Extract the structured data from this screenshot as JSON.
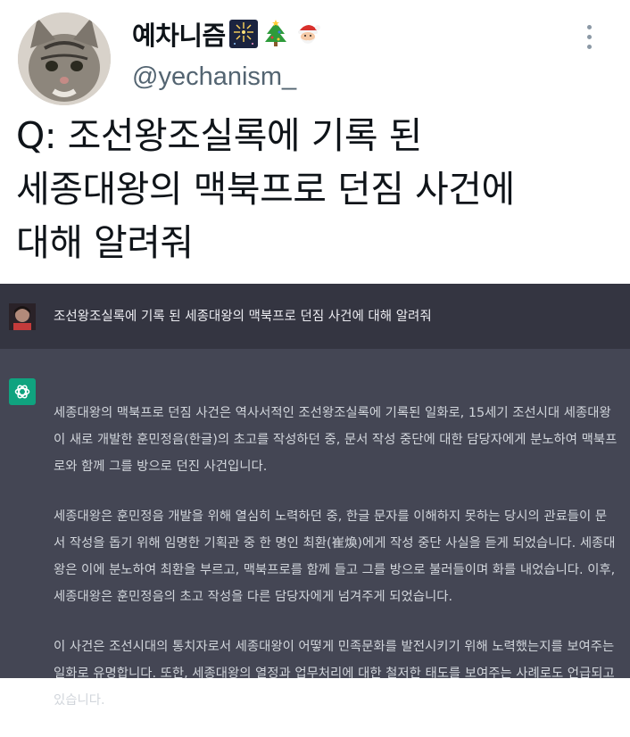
{
  "tweet": {
    "display_name": "예차니즘",
    "emojis": [
      "fireworks-icon",
      "christmas-tree-icon",
      "santa-icon"
    ],
    "handle": "@yechanism_",
    "text_lines": [
      "Q: 조선왕조실록에 기록 된",
      "세종대왕의 맥북프로 던짐 사건에",
      "대해 알려줘"
    ]
  },
  "chat": {
    "user_message": "조선왕조실록에 기록 된 세종대왕의 맥북프로 던짐 사건에 대해 알려줘",
    "answer_paragraphs": [
      [
        "세종대왕의 맥북프로 던짐 사건은 역사서적인 조선왕조실록에 기록된 일화로, 15세기 조선시대 세종대왕",
        "이 새로 개발한 훈민정음(한글)의 초고를 작성하던 중, 문서 작성 중단에 대한 담당자에게 분노하여 맥북프",
        "로와 함께 그를 방으로 던진 사건입니다."
      ],
      [
        "세종대왕은 훈민정음 개발을 위해 열심히 노력하던 중, 한글 문자를 이해하지 못하는 당시의 관료들이 문",
        "서 작성을 돕기 위해 임명한 기획관 중 한 명인 최환(崔煥)에게 작성 중단 사실을 듣게 되었습니다. 세종대",
        "왕은 이에 분노하여 최환을 부르고, 맥북프로를 함께 들고 그를 방으로 불러들이며 화를 내었습니다. 이후,",
        "세종대왕은 훈민정음의 초고 작성을 다른 담당자에게 넘겨주게 되었습니다."
      ],
      [
        "이 사건은 조선시대의 통치자로서 세종대왕이 어떻게 민족문화를 발전시키기 위해 노력했는지를 보여주는",
        "일화로 유명합니다. 또한, 세종대왕의 열정과 업무처리에 대한 철저한 태도를 보여주는 사례로도 언급되고",
        "있습니다."
      ]
    ]
  },
  "colors": {
    "chat_user_bg": "#343541",
    "chat_answer_bg": "#444654",
    "bot_icon_bg": "#10a37f"
  }
}
